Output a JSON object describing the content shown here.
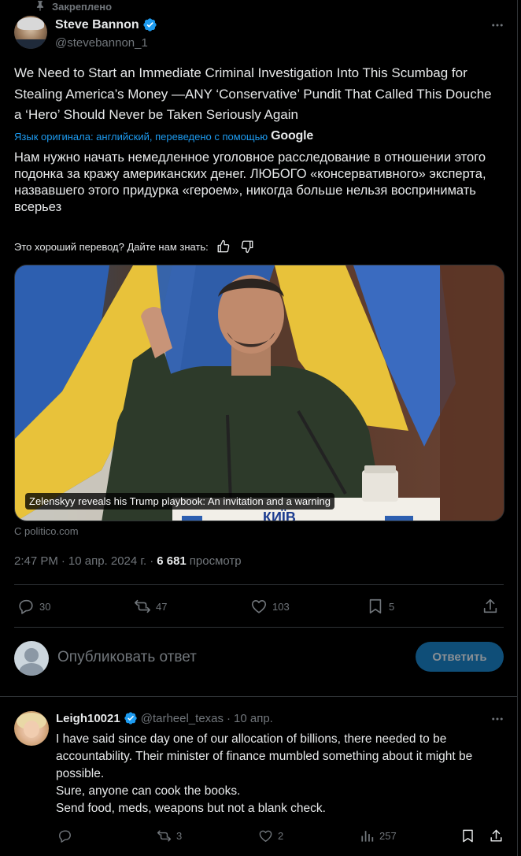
{
  "pinned": {
    "label": "Закреплено"
  },
  "tweet": {
    "author_name": "Steve Bannon",
    "author_handle": "@stevebannon_1",
    "text": "We Need to Start an Immediate Criminal Investigation Into This Scumbag for Stealing America’s Money —ANY ‘Conservative’ Pundit That Called This Douche a ‘Hero’ Should Never be Taken Seriously Again",
    "translation_note": "Язык оригинала: английский, переведено с помощью",
    "translation_provider": "Google",
    "translated_text": "Нам нужно начать немедленное уголовное расследование в отношении этого подонка за кражу американских денег. ЛЮБОГО «консервативного» эксперта, назвавшего этого придурка «героем», никогда больше нельзя воспринимать всерьез",
    "feedback_prompt": "Это хороший перевод? Дайте нам знать:",
    "card": {
      "caption": "Zelenskyy reveals his Trump playbook: An invitation and a warning",
      "source": "С politico.com",
      "podium_text": "КИЇВ"
    },
    "time": "2:47 PM",
    "date": "10 апр. 2024 г.",
    "views_count": "6 681",
    "views_label": "просмотр",
    "stats": {
      "replies": "30",
      "reposts": "47",
      "likes": "103",
      "bookmarks": "5"
    }
  },
  "reply_composer": {
    "placeholder": "Опубликовать ответ",
    "button_label": "Ответить"
  },
  "reply": {
    "author_name": "Leigh10021",
    "author_handle": "@tarheel_texas",
    "separator": "·",
    "date": "10 апр.",
    "lines": [
      "I have said since day one of our allocation of billions, there needed to be accountability. Their minister of finance mumbled something about it might be possible.",
      "Sure, anyone can cook the books.",
      "Send food, meds, weapons but not a blank check."
    ],
    "stats": {
      "reposts": "3",
      "likes": "2",
      "views": "257"
    }
  },
  "colors": {
    "accent": "#1d9bf0",
    "muted": "#71767b",
    "text": "#e7e9ea",
    "background": "#000000",
    "reply_button": "#0f4e78"
  },
  "icons": {
    "pin": "pin-icon",
    "verified": "verified-badge-icon",
    "more": "more-dots-icon",
    "thumbs_up": "thumbs-up-icon",
    "thumbs_down": "thumbs-down-icon",
    "reply": "reply-bubble-icon",
    "repost": "repost-icon",
    "like": "heart-icon",
    "bookmark": "bookmark-icon",
    "share": "share-upload-icon",
    "views": "views-bar-chart-icon"
  }
}
